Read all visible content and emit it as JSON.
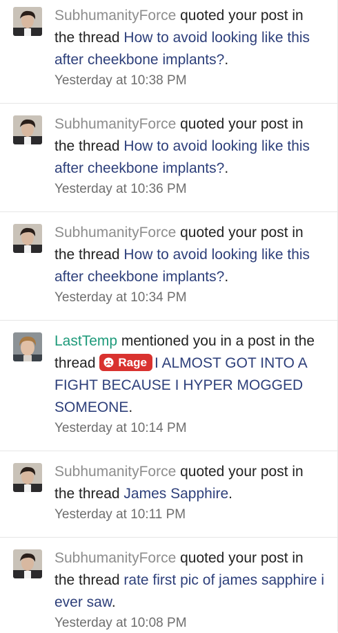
{
  "alerts": [
    {
      "user": "SubhumanityForce",
      "action": " quoted your post in the thread ",
      "has_prefix": false,
      "thread_title": "How to avoid looking like this after cheekbone implants?",
      "suffix": ".",
      "time": "Yesterday at 10:38 PM"
    },
    {
      "user": "SubhumanityForce",
      "action": " quoted your post in the thread ",
      "has_prefix": false,
      "thread_title": "How to avoid looking like this after cheekbone implants?",
      "suffix": ".",
      "time": "Yesterday at 10:36 PM"
    },
    {
      "user": "SubhumanityForce",
      "action": " quoted your post in the thread ",
      "has_prefix": false,
      "thread_title": "How to avoid looking like this after cheekbone implants?",
      "suffix": ".",
      "time": "Yesterday at 10:34 PM"
    },
    {
      "user": "LastTemp",
      "action": " mentioned you in a post in the thread ",
      "has_prefix": true,
      "prefix": "Rage",
      "thread_title": "I ALMOST GOT INTO A FIGHT BECAUSE I HYPER MOGGED SOMEONE",
      "suffix": ".",
      "time": "Yesterday at 10:14 PM"
    },
    {
      "user": "SubhumanityForce",
      "action": " quoted your post in the thread ",
      "has_prefix": false,
      "thread_title": "James Sapphire",
      "suffix": ".",
      "time": "Yesterday at 10:11 PM"
    },
    {
      "user": "SubhumanityForce",
      "action": " quoted your post in the thread ",
      "has_prefix": false,
      "thread_title": "rate first pic of james sapphire i ever saw",
      "suffix": ".",
      "time": "Yesterday at 10:08 PM"
    }
  ],
  "colors": {
    "username_subhumanity": "#8d8d8d",
    "username_lasttemp": "#1e9a7a",
    "thread_link": "#2d3f7a",
    "prefix_rage_bg": "#d9322f",
    "time_text": "#6e6e6e",
    "divider": "#e6e6e6"
  },
  "icons": {
    "avatar_subhumanity": "user-avatar-dark-hair",
    "avatar_lasttemp": "user-avatar-blond-hair",
    "prefix_rage": "angry-face-icon"
  }
}
